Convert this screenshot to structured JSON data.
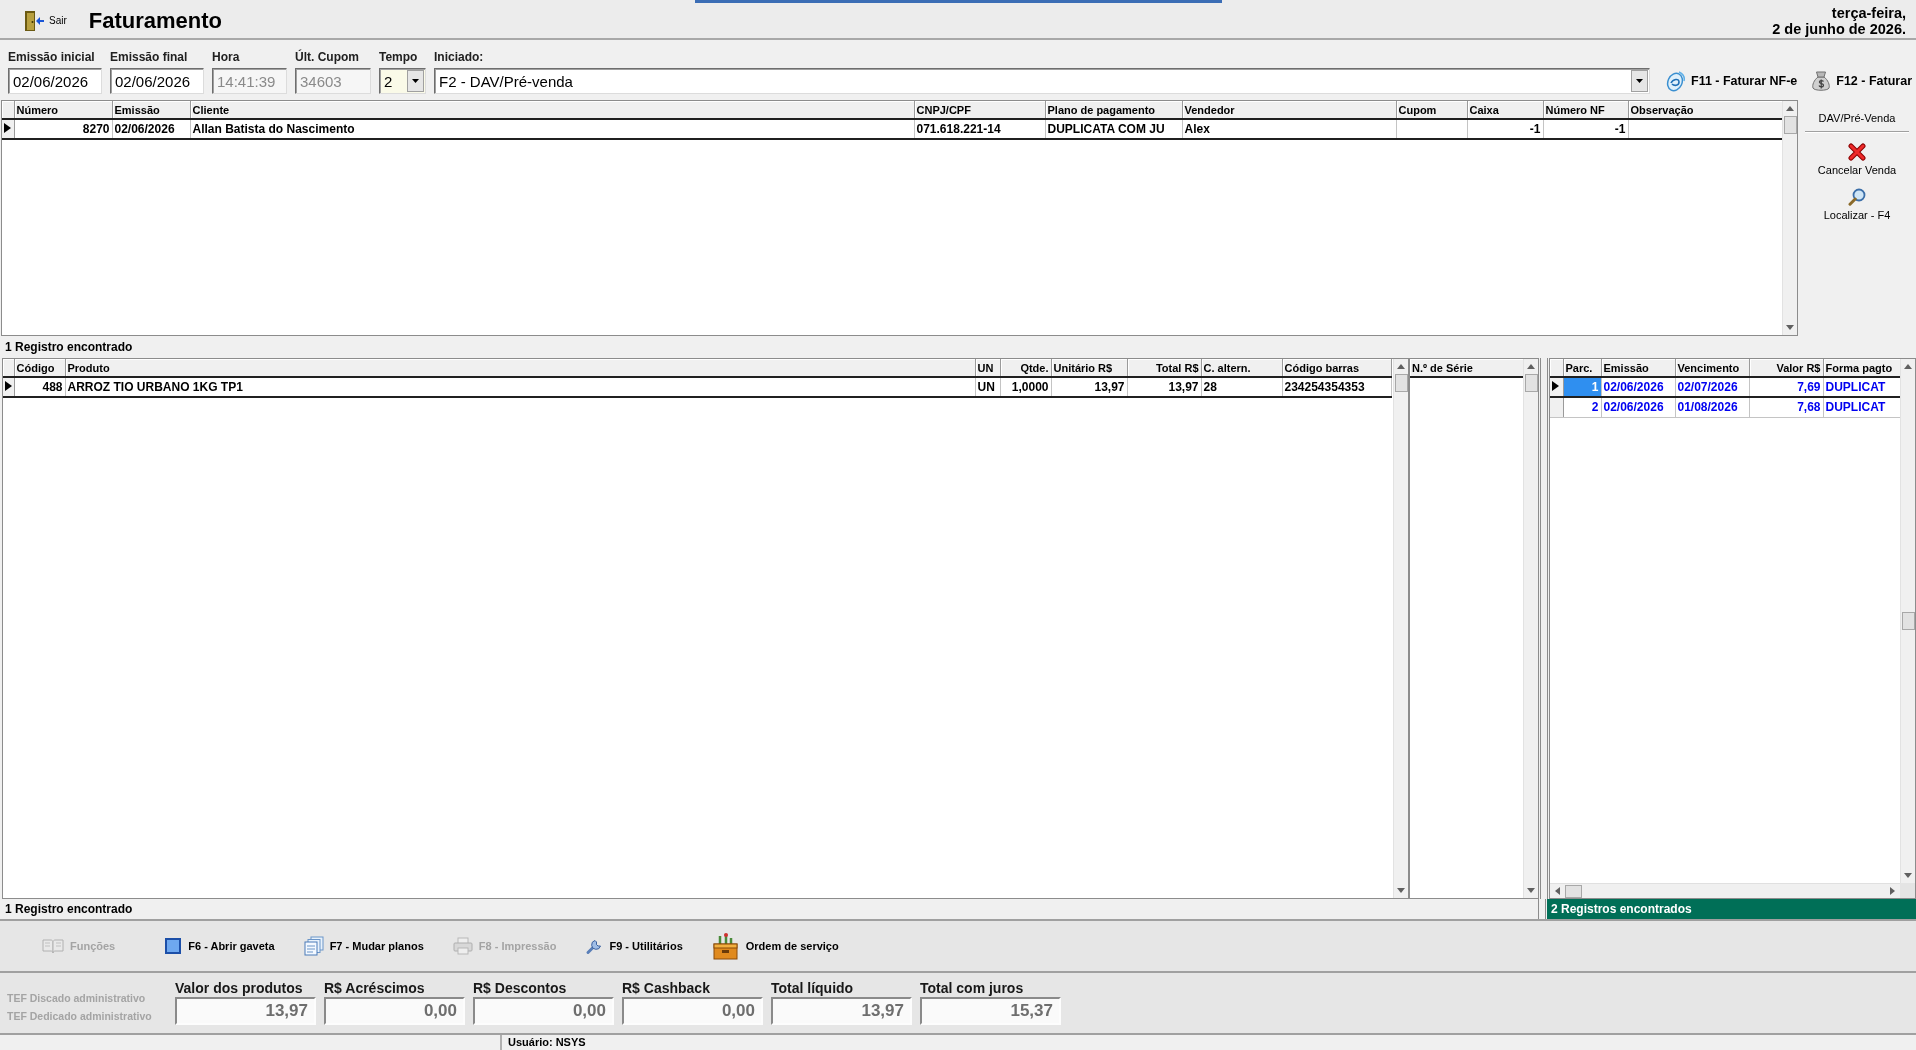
{
  "header": {
    "exit_label": "Sair",
    "title": "Faturamento",
    "weekday": "terça-feira,",
    "date": "2 de junho de 2026."
  },
  "filters": [
    {
      "kind": "date",
      "label": "Emissão inicial",
      "value": "02/06/2026",
      "disabled": false
    },
    {
      "kind": "date",
      "label": "Emissão final",
      "value": "02/06/2026",
      "disabled": false
    },
    {
      "kind": "time",
      "label": "Hora",
      "value": "14:41:39",
      "disabled": true
    },
    {
      "kind": "number",
      "label": "Últ. Cupom",
      "value": "34603",
      "disabled": true
    },
    {
      "kind": "select",
      "label": "Tempo",
      "value": "2",
      "disabled": false
    },
    {
      "kind": "combo",
      "label": "Iniciado:",
      "value": "F2 - DAV/Pré-venda",
      "disabled": false
    }
  ],
  "actions": [
    {
      "kind": "nfe",
      "label": "F11 - Faturar NF-e"
    },
    {
      "kind": "invoice",
      "label": "F12 - Faturar"
    }
  ],
  "sales_table": {
    "columns": [
      "Número",
      "Emissão",
      "Cliente",
      "CNPJ/CPF",
      "Plano de pagamento",
      "Vendedor",
      "Cupom",
      "Caixa",
      "Número NF",
      "Observação"
    ],
    "rows": [
      {
        "selected": true,
        "cells": [
          "8270",
          "02/06/2026",
          "Allan Batista do Nascimento",
          "071.618.221-14",
          "DUPLICATA COM JU",
          "Alex",
          null,
          "-1",
          "-1",
          null
        ]
      }
    ],
    "record_count": "1 Registro encontrado"
  },
  "side_panel": {
    "title": "DAV/Pré-Venda",
    "buttons": [
      {
        "kind": "cancel",
        "label": "Cancelar Venda"
      },
      {
        "kind": "search",
        "label": "Localizar - F4"
      }
    ]
  },
  "items_table": {
    "columns": [
      "Código",
      "Produto",
      "UN",
      "Qtde.",
      "Unitário R$",
      "Total R$",
      "C. altern.",
      "Código barras"
    ],
    "rows": [
      {
        "selected": true,
        "cells": [
          "488",
          "ARROZ TIO URBANO 1KG TP1",
          "UN",
          "1,0000",
          "13,97",
          "13,97",
          "28",
          "234254354353"
        ]
      }
    ],
    "record_count": "1 Registro encontrado"
  },
  "serial_table": {
    "columns": [
      "N.º de Série"
    ]
  },
  "installments_table": {
    "columns": [
      "Parc.",
      "Emissão",
      "Vencimento",
      "Valor R$",
      "Forma pagto"
    ],
    "rows": [
      {
        "selected": true,
        "cells": [
          "1",
          "02/06/2026",
          "02/07/2026",
          "7,69",
          "DUPLICAT"
        ]
      },
      {
        "selected": false,
        "cells": [
          "2",
          "02/06/2026",
          "01/08/2026",
          "7,68",
          "DUPLICAT"
        ]
      }
    ],
    "record_count": "2 Registros encontrados"
  },
  "function_bar": [
    {
      "kind": "functions",
      "label": "Funções",
      "disabled": true
    },
    {
      "kind": "drawer",
      "label": "F6 - Abrir gaveta",
      "disabled": false
    },
    {
      "kind": "plans",
      "label": "F7 - Mudar planos",
      "disabled": false
    },
    {
      "kind": "print",
      "label": "F8 - Impressão",
      "disabled": true
    },
    {
      "kind": "utilities",
      "label": "F9 - Utilitários",
      "disabled": false
    },
    {
      "kind": "service",
      "label": "Ordem de serviço",
      "disabled": false
    }
  ],
  "tef_options": [
    {
      "label": "TEF Discado administrativo",
      "disabled": true
    },
    {
      "label": "TEF Dedicado administrativo",
      "disabled": true
    }
  ],
  "totals": [
    {
      "label": "Valor dos produtos",
      "value": "13,97"
    },
    {
      "label": "R$ Acréscimos",
      "value": "0,00"
    },
    {
      "label": "R$ Descontos",
      "value": "0,00"
    },
    {
      "label": "R$ Cashback",
      "value": "0,00"
    },
    {
      "label": "Total líquido",
      "value": "13,97"
    },
    {
      "label": "Total com juros",
      "value": "15,37"
    }
  ],
  "status_bar": {
    "user": "Usuário: NSYS"
  }
}
